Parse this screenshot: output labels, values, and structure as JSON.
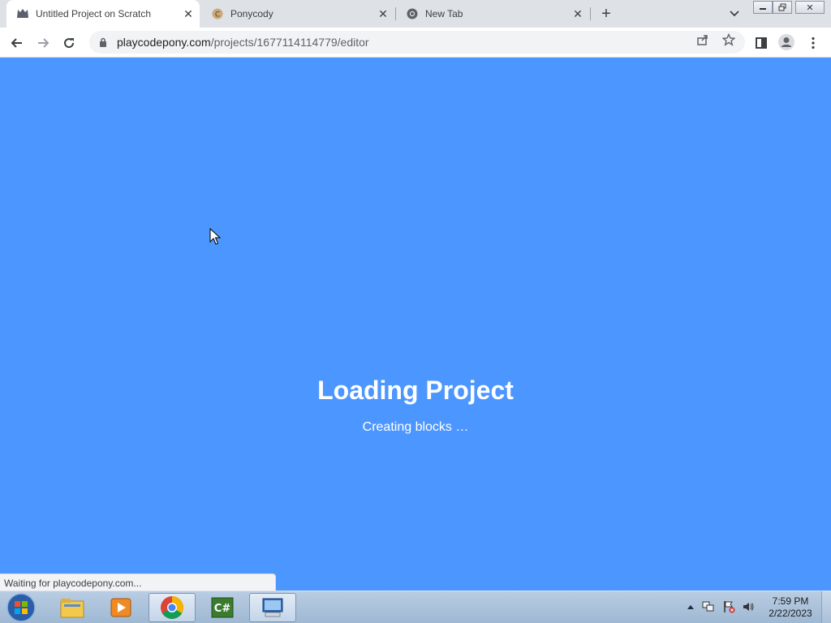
{
  "browser": {
    "tabs": [
      {
        "title": "Untitled Project on Scratch",
        "icon": "scratch-cat-icon",
        "active": true
      },
      {
        "title": "Ponycody",
        "icon": "ponycody-icon",
        "active": false
      },
      {
        "title": "New Tab",
        "icon": "chrome-icon",
        "active": false
      }
    ],
    "address": {
      "domain": "playcodepony.com",
      "path": "/projects/1677114114779/editor"
    },
    "status_text": "Waiting for playcodepony.com..."
  },
  "page": {
    "loading_title": "Loading Project",
    "loading_subtitle": "Creating blocks …",
    "background_color": "#4c97ff"
  },
  "taskbar": {
    "apps": [
      "windows-explorer-icon",
      "media-player-icon",
      "chrome-icon",
      "csharp-ide-icon",
      "remote-desktop-icon"
    ],
    "clock_time": "7:59 PM",
    "clock_date": "2/22/2023"
  }
}
